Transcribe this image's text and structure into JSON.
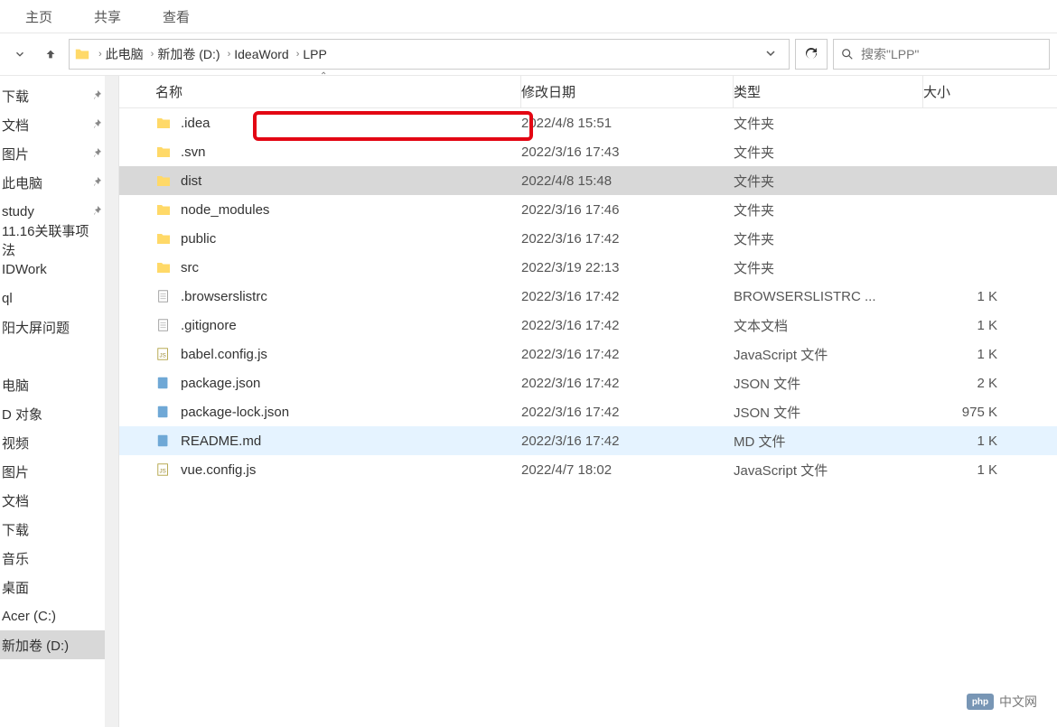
{
  "tabs": {
    "home": "主页",
    "share": "共享",
    "view": "查看"
  },
  "breadcrumb": {
    "segments": [
      "此电脑",
      "新加卷 (D:)",
      "IdeaWord",
      "LPP"
    ]
  },
  "search": {
    "placeholder": "搜索\"LPP\""
  },
  "columns": {
    "name": "名称",
    "modified": "修改日期",
    "type": "类型",
    "size": "大小"
  },
  "sidebar": {
    "items": [
      {
        "label": "下载",
        "pinned": true
      },
      {
        "label": "文档",
        "pinned": true
      },
      {
        "label": "图片",
        "pinned": true
      },
      {
        "label": "此电脑",
        "pinned": true
      },
      {
        "label": "study",
        "pinned": true
      },
      {
        "label": "11.16关联事项法",
        "pinned": false
      },
      {
        "label": "IDWork",
        "pinned": false
      },
      {
        "label": "ql",
        "pinned": false
      },
      {
        "label": "阳大屏问题",
        "pinned": false
      },
      {
        "label": "",
        "pinned": false
      },
      {
        "label": "电脑",
        "pinned": false
      },
      {
        "label": "D 对象",
        "pinned": false
      },
      {
        "label": "视频",
        "pinned": false
      },
      {
        "label": "图片",
        "pinned": false
      },
      {
        "label": "文档",
        "pinned": false
      },
      {
        "label": "下载",
        "pinned": false
      },
      {
        "label": "音乐",
        "pinned": false
      },
      {
        "label": "桌面",
        "pinned": false
      },
      {
        "label": "Acer (C:)",
        "pinned": false
      },
      {
        "label": "新加卷 (D:)",
        "pinned": false,
        "selected": true
      }
    ]
  },
  "files": {
    "items": [
      {
        "name": ".idea",
        "modified": "2022/4/8 15:51",
        "type": "文件夹",
        "size": "",
        "icon": "folder"
      },
      {
        "name": ".svn",
        "modified": "2022/3/16 17:43",
        "type": "文件夹",
        "size": "",
        "icon": "folder"
      },
      {
        "name": "dist",
        "modified": "2022/4/8 15:48",
        "type": "文件夹",
        "size": "",
        "icon": "folder",
        "selected": true,
        "highlighted": true
      },
      {
        "name": "node_modules",
        "modified": "2022/3/16 17:46",
        "type": "文件夹",
        "size": "",
        "icon": "folder"
      },
      {
        "name": "public",
        "modified": "2022/3/16 17:42",
        "type": "文件夹",
        "size": "",
        "icon": "folder"
      },
      {
        "name": "src",
        "modified": "2022/3/19 22:13",
        "type": "文件夹",
        "size": "",
        "icon": "folder"
      },
      {
        "name": ".browserslistrc",
        "modified": "2022/3/16 17:42",
        "type": "BROWSERSLISTRC ...",
        "size": "1 K",
        "icon": "file"
      },
      {
        "name": ".gitignore",
        "modified": "2022/3/16 17:42",
        "type": "文本文档",
        "size": "1 K",
        "icon": "file"
      },
      {
        "name": "babel.config.js",
        "modified": "2022/3/16 17:42",
        "type": "JavaScript 文件",
        "size": "1 K",
        "icon": "js"
      },
      {
        "name": "package.json",
        "modified": "2022/3/16 17:42",
        "type": "JSON 文件",
        "size": "2 K",
        "icon": "json"
      },
      {
        "name": "package-lock.json",
        "modified": "2022/3/16 17:42",
        "type": "JSON 文件",
        "size": "975 K",
        "icon": "json"
      },
      {
        "name": "README.md",
        "modified": "2022/3/16 17:42",
        "type": "MD 文件",
        "size": "1 K",
        "icon": "json",
        "hover": true
      },
      {
        "name": "vue.config.js",
        "modified": "2022/4/7 18:02",
        "type": "JavaScript 文件",
        "size": "1 K",
        "icon": "js"
      }
    ]
  },
  "watermark": "中文网"
}
